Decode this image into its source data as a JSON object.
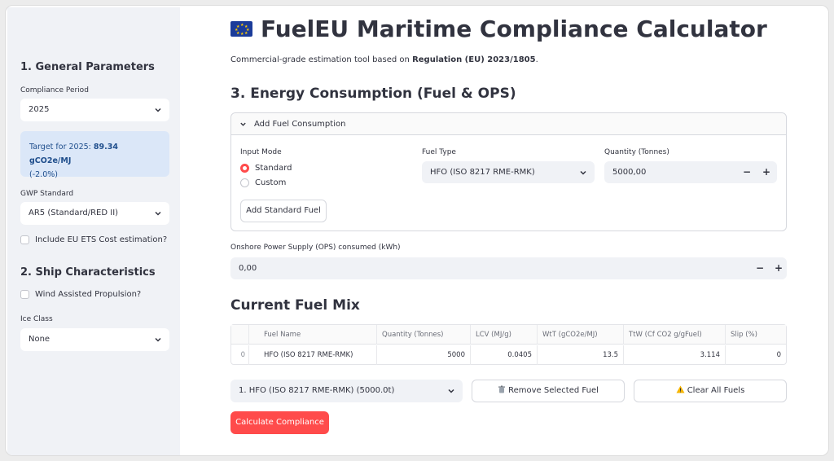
{
  "sidebar": {
    "general_heading": "1. General Parameters",
    "compliance_period_label": "Compliance Period",
    "compliance_period_value": "2025",
    "target_prefix": "Target for 2025: ",
    "target_value": "89.34 gCO2e/MJ",
    "target_suffix": "(-2.0%)",
    "gwp_label": "GWP Standard",
    "gwp_value": "AR5 (Standard/RED II)",
    "ets_checkbox": "Include EU ETS Cost estimation?",
    "ship_heading": "2. Ship Characteristics",
    "wind_checkbox": "Wind Assisted Propulsion?",
    "ice_label": "Ice Class",
    "ice_value": "None"
  },
  "main": {
    "title": "FuelEU Maritime Compliance Calculator",
    "subtitle_prefix": "Commercial-grade estimation tool based on ",
    "subtitle_bold": "Regulation (EU) 2023/1805",
    "subtitle_suffix": ".",
    "energy_heading": "3. Energy Consumption (Fuel & OPS)",
    "expander_label": "Add Fuel Consumption",
    "input_mode_label": "Input Mode",
    "radio_standard": "Standard",
    "radio_custom": "Custom",
    "fuel_type_label": "Fuel Type",
    "fuel_type_value": "HFO (ISO 8217 RME-RMK)",
    "quantity_label": "Quantity (Tonnes)",
    "quantity_value": "5000,00",
    "add_fuel_button": "Add Standard Fuel",
    "ops_label": "Onshore Power Supply (OPS) consumed (kWh)",
    "ops_value": "0,00",
    "minus": "−",
    "plus": "+",
    "mix_heading": "Current Fuel Mix",
    "table": {
      "headers": [
        "",
        "Fuel Name",
        "Quantity (Tonnes)",
        "LCV (MJ/g)",
        "WtT (gCO2e/MJ)",
        "TtW (Cf CO2 g/gFuel)",
        "Slip (%)"
      ],
      "rows": [
        [
          "0",
          "HFO (ISO 8217 RME-RMK)",
          "5000",
          "0.0405",
          "13.5",
          "3.114",
          "0"
        ]
      ]
    },
    "selected_fuel": "1. HFO (ISO 8217 RME-RMK) (5000.0t)",
    "remove_button": "Remove Selected Fuel",
    "clear_button": "Clear All Fuels",
    "calc_button": "Calculate Compliance"
  },
  "colors": {
    "accent": "#ff4b4b",
    "sidebar_bg": "#f0f2f6",
    "info_bg": "#dbe7f8",
    "info_text": "#1f4e8c"
  }
}
